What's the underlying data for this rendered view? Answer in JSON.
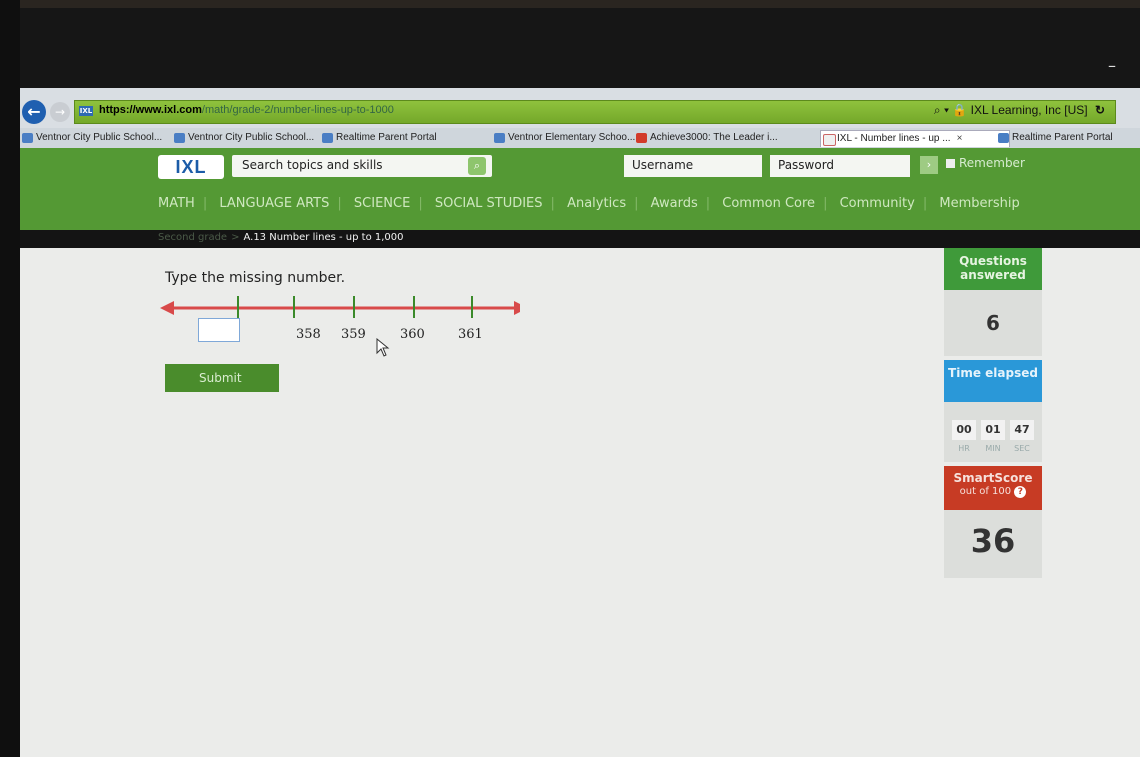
{
  "browser": {
    "url_scheme": "https://",
    "url_host": "www.ixl.com",
    "url_path": "/math/grade-2/number-lines-up-to-1000",
    "site_identity": "IXL Learning, Inc [US]",
    "tabs": [
      {
        "label": "Ventnor City Public School..."
      },
      {
        "label": "Ventnor City Public School..."
      },
      {
        "label": "Realtime Parent Portal"
      },
      {
        "label": "Ventnor Elementary Schoo..."
      },
      {
        "label": "Achieve3000: The Leader i..."
      },
      {
        "label": "IXL - Number lines - up ...",
        "close": "×"
      },
      {
        "label": "Realtime Parent Portal"
      }
    ]
  },
  "header": {
    "logo": "IXL",
    "search_placeholder": "Search topics and skills",
    "username_placeholder": "Username",
    "password_placeholder": "Password",
    "remember_label": "Remember",
    "nav": [
      "MATH",
      "LANGUAGE ARTS",
      "SCIENCE",
      "SOCIAL STUDIES",
      "Analytics",
      "Awards",
      "Common Core",
      "Community",
      "Membership"
    ]
  },
  "breadcrumb": {
    "grade": "Second grade",
    "separator": ">",
    "skill": "A.13 Number lines - up to 1,000"
  },
  "question": {
    "prompt": "Type the missing number.",
    "answer_value": "",
    "tick_labels": [
      "358",
      "359",
      "360",
      "361"
    ],
    "submit_label": "Submit"
  },
  "sidebar": {
    "questions_label": "Questions answered",
    "questions_value": "6",
    "time_label": "Time elapsed",
    "time": {
      "hr": "00",
      "min": "01",
      "sec": "47"
    },
    "time_units": {
      "hr": "HR",
      "min": "MIN",
      "sec": "SEC"
    },
    "smartscore_label": "SmartScore",
    "smartscore_sub": "out of 100",
    "smartscore_value": "36"
  },
  "colors": {
    "ixl_green": "#549934",
    "questions_green": "#3f9a3a",
    "time_blue": "#2a98d8",
    "score_red": "#c73b24",
    "numberline_red": "#d84a4a",
    "tick_green": "#3b8a2a"
  }
}
